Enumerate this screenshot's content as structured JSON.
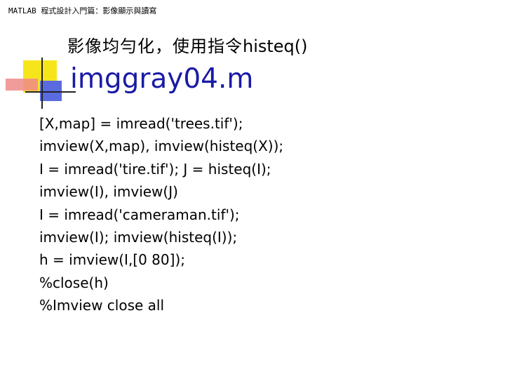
{
  "header": {
    "text": "MATLAB 程式設計入門篇：影像顯示與讀寫"
  },
  "slide": {
    "subtitle_cjk": "影像均勻化，使用指令",
    "subtitle_func": "histeq()",
    "title": "imggray04.m",
    "code_lines": [
      "[X,map] = imread('trees.tif');",
      "imview(X,map), imview(histeq(X));",
      "I = imread('tire.tif'); J = histeq(I);",
      "imview(I), imview(J)",
      "I = imread('cameraman.tif');",
      "imview(I); imview(histeq(I));",
      "h = imview(I,[0 80]);",
      "%close(h)",
      "%Imview close all"
    ]
  },
  "colors": {
    "title": "#1a1aa6",
    "deco_yellow": "#f7e51c",
    "deco_red": "#f08a8a",
    "deco_blue": "#5a6be0",
    "deco_line": "#222222"
  }
}
